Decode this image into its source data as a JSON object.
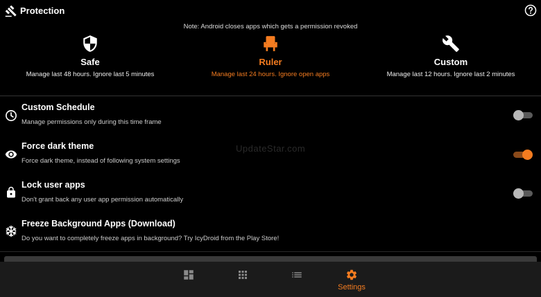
{
  "header": {
    "title": "Protection",
    "app_icon": "gavel-icon",
    "help_icon": "help-circle-icon"
  },
  "note": "Note: Android closes apps which gets a permission revoked",
  "modes": [
    {
      "name": "Safe",
      "description": "Manage last 48 hours. Ignore last 5 minutes",
      "icon": "shield-icon",
      "active": false
    },
    {
      "name": "Ruler",
      "description": "Manage last 24 hours. Ignore open apps",
      "icon": "throne-icon",
      "active": true
    },
    {
      "name": "Custom",
      "description": "Manage last 12 hours. Ignore last 2 minutes",
      "icon": "wrench-icon",
      "active": false
    }
  ],
  "settings": [
    {
      "title": "Custom Schedule",
      "description": "Manage permissions only during this time frame",
      "icon": "clock-icon",
      "toggle": false
    },
    {
      "title": "Force dark theme",
      "description": "Force dark theme, instead of following system settings",
      "icon": "eye-icon",
      "toggle": true
    },
    {
      "title": "Lock user apps",
      "description": "Don't grant back any user app permission automatically",
      "icon": "lock-icon",
      "toggle": false
    },
    {
      "title": "Freeze Background Apps (Download)",
      "description": "Do you want to completely freeze apps in background? Try IcyDroid from the Play Store!",
      "icon": "snowflake-icon"
    }
  ],
  "watermark": "UpdateStar.com",
  "bottom_nav": [
    {
      "icon": "dashboard-icon",
      "label": ""
    },
    {
      "icon": "grid-icon",
      "label": ""
    },
    {
      "icon": "list-icon",
      "label": ""
    },
    {
      "icon": "settings-icon",
      "label": "Settings",
      "active": true
    }
  ],
  "colors": {
    "accent": "#f47c20",
    "background": "#000000",
    "nav_background": "#1b1b1b"
  }
}
